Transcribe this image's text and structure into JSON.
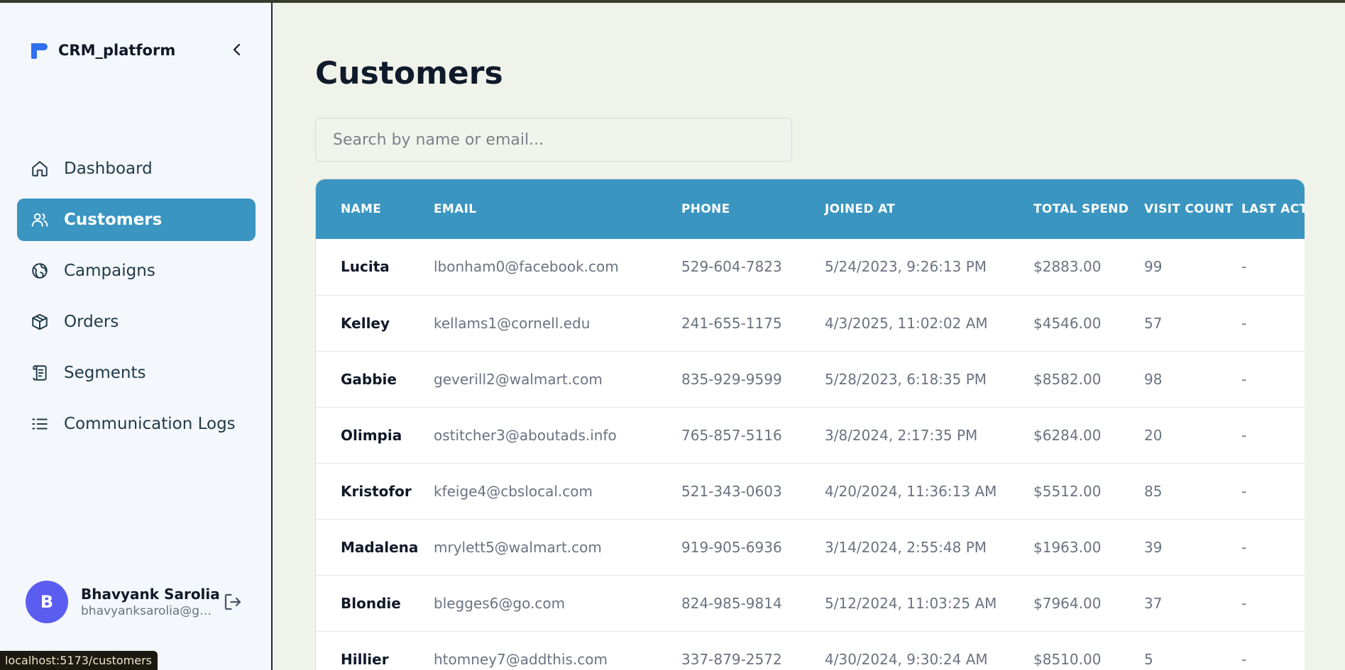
{
  "app": {
    "name": "CRM_platform"
  },
  "sidebar": {
    "items": [
      {
        "label": "Dashboard",
        "icon": "home-icon",
        "active": false
      },
      {
        "label": "Customers",
        "icon": "users-icon",
        "active": true
      },
      {
        "label": "Campaigns",
        "icon": "globe-icon",
        "active": false
      },
      {
        "label": "Orders",
        "icon": "package-icon",
        "active": false
      },
      {
        "label": "Segments",
        "icon": "scroll-icon",
        "active": false
      },
      {
        "label": "Communication Logs",
        "icon": "list-icon",
        "active": false
      }
    ],
    "user": {
      "initial": "B",
      "name": "Bhavyank Sarolia",
      "email": "bhavyanksarolia@gm..."
    }
  },
  "main": {
    "title": "Customers",
    "search": {
      "placeholder": "Search by name or email...",
      "value": ""
    },
    "table": {
      "columns": [
        "NAME",
        "EMAIL",
        "PHONE",
        "JOINED AT",
        "TOTAL SPEND",
        "VISIT COUNT",
        "LAST ACTIVITY"
      ],
      "rows": [
        [
          "Lucita",
          "lbonham0@facebook.com",
          "529-604-7823",
          "5/24/2023, 9:26:13 PM",
          "$2883.00",
          "99",
          "-"
        ],
        [
          "Kelley",
          "kellams1@cornell.edu",
          "241-655-1175",
          "4/3/2025, 11:02:02 AM",
          "$4546.00",
          "57",
          "-"
        ],
        [
          "Gabbie",
          "geverill2@walmart.com",
          "835-929-9599",
          "5/28/2023, 6:18:35 PM",
          "$8582.00",
          "98",
          "-"
        ],
        [
          "Olimpia",
          "ostitcher3@aboutads.info",
          "765-857-5116",
          "3/8/2024, 2:17:35 PM",
          "$6284.00",
          "20",
          "-"
        ],
        [
          "Kristofor",
          "kfeige4@cbslocal.com",
          "521-343-0603",
          "4/20/2024, 11:36:13 AM",
          "$5512.00",
          "85",
          "-"
        ],
        [
          "Madalena",
          "mrylett5@walmart.com",
          "919-905-6936",
          "3/14/2024, 2:55:48 PM",
          "$1963.00",
          "39",
          "-"
        ],
        [
          "Blondie",
          "blegges6@go.com",
          "824-985-9814",
          "5/12/2024, 11:03:25 AM",
          "$7964.00",
          "37",
          "-"
        ],
        [
          "Hillier",
          "htomney7@addthis.com",
          "337-879-2572",
          "4/30/2024, 9:30:24 AM",
          "$8510.00",
          "5",
          "-"
        ]
      ]
    }
  },
  "status_bar": {
    "url": "localhost:5173/customers"
  },
  "colors": {
    "accent": "#3a95c0",
    "brand_logo": "#2f6ff0",
    "avatar": "#5b5cf0",
    "background": "#f0f3ea"
  }
}
